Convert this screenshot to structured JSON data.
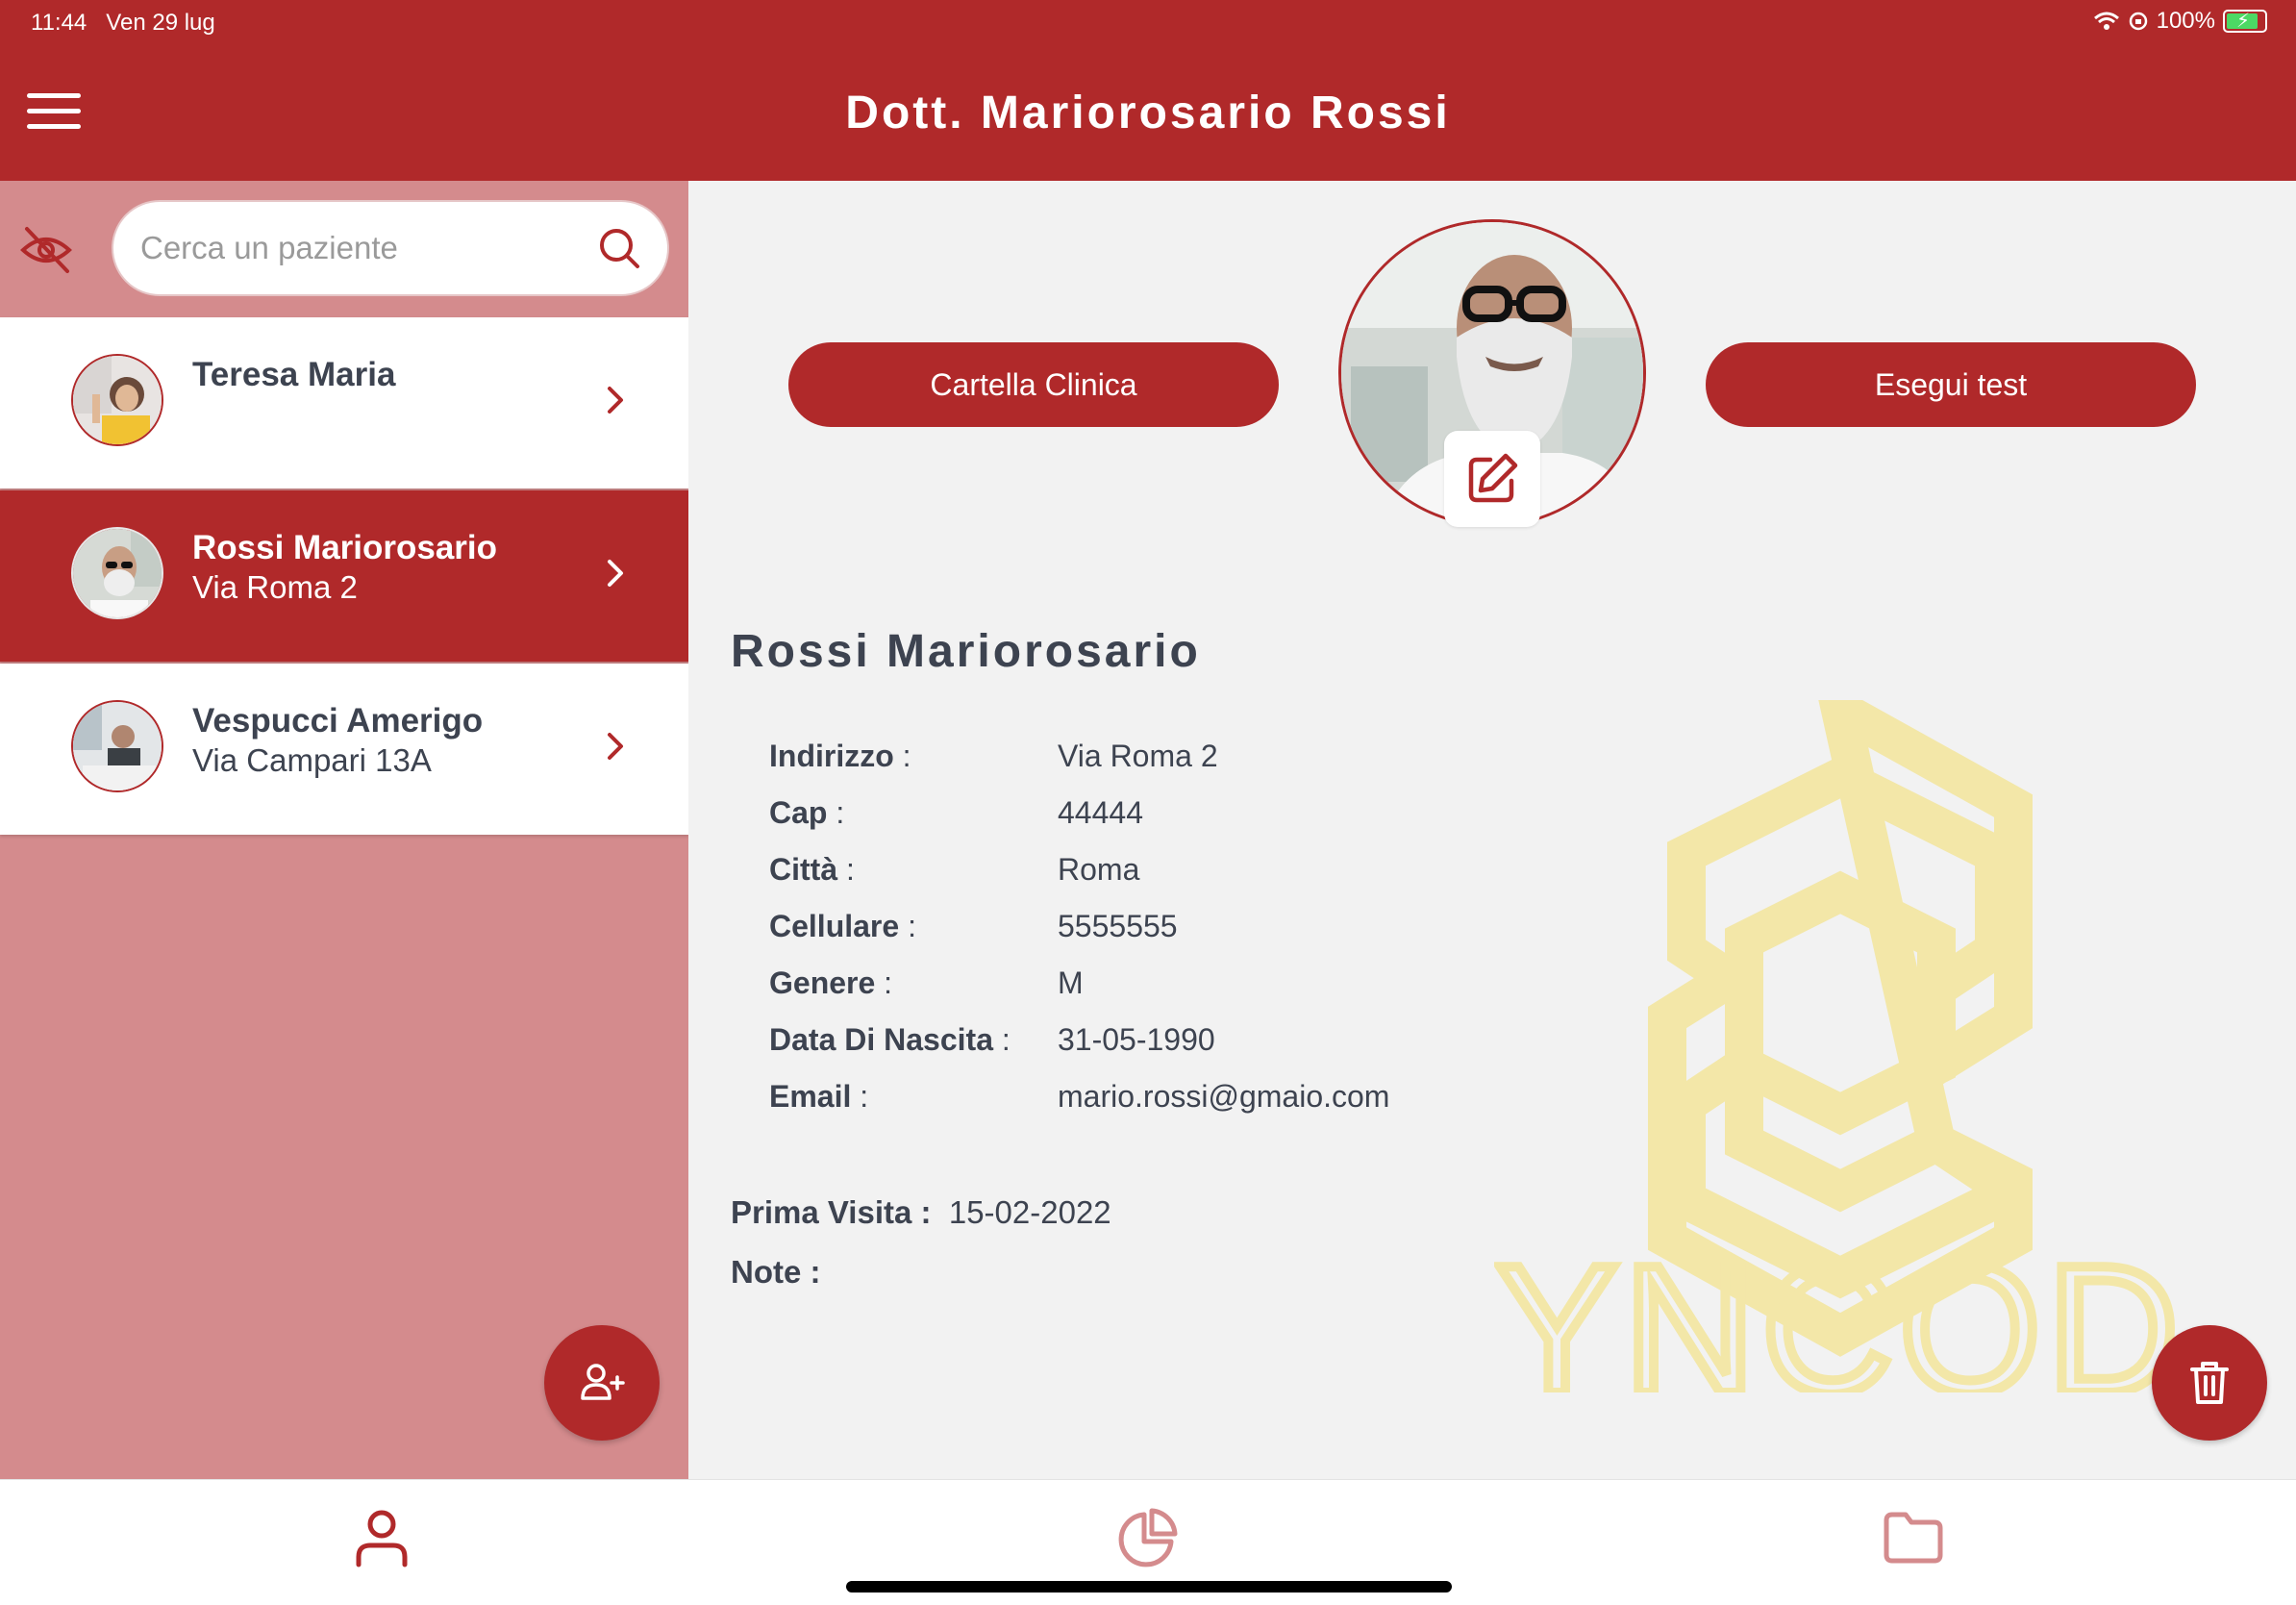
{
  "status_bar": {
    "time": "11:44",
    "date": "Ven 29 lug",
    "battery": "100%"
  },
  "header": {
    "title": "Dott. Mariorosario Rossi"
  },
  "search": {
    "placeholder": "Cerca un paziente"
  },
  "patients": [
    {
      "name": "Teresa Maria",
      "address": ""
    },
    {
      "name": "Rossi Mariorosario",
      "address": "Via Roma 2"
    },
    {
      "name": "Vespucci Amerigo",
      "address": "Via Campari 13A"
    }
  ],
  "actions": {
    "cartella": "Cartella Clinica",
    "esegui": "Esegui test"
  },
  "patient": {
    "full_name": "Rossi Mariorosario",
    "fields": [
      {
        "label": "Indirizzo",
        "value": "Via Roma 2"
      },
      {
        "label": "Cap",
        "value": "44444"
      },
      {
        "label": "Città",
        "value": "Roma"
      },
      {
        "label": "Cellulare",
        "value": "5555555"
      },
      {
        "label": "Genere",
        "value": "M"
      },
      {
        "label": "Data Di Nascita",
        "value": "31-05-1990"
      },
      {
        "label": "Email",
        "value": "mario.rossi@gmaio.com"
      }
    ],
    "first_visit_label": "Prima Visita :",
    "first_visit": "15-02-2022",
    "notes_label": "Note :",
    "label_separator": " :"
  },
  "watermark": {
    "text": "SYNCODE",
    "color": "#f3e7a8"
  },
  "colors": {
    "primary": "#b0292a",
    "sidebar": "#d48b8d",
    "text": "#3d4350"
  }
}
